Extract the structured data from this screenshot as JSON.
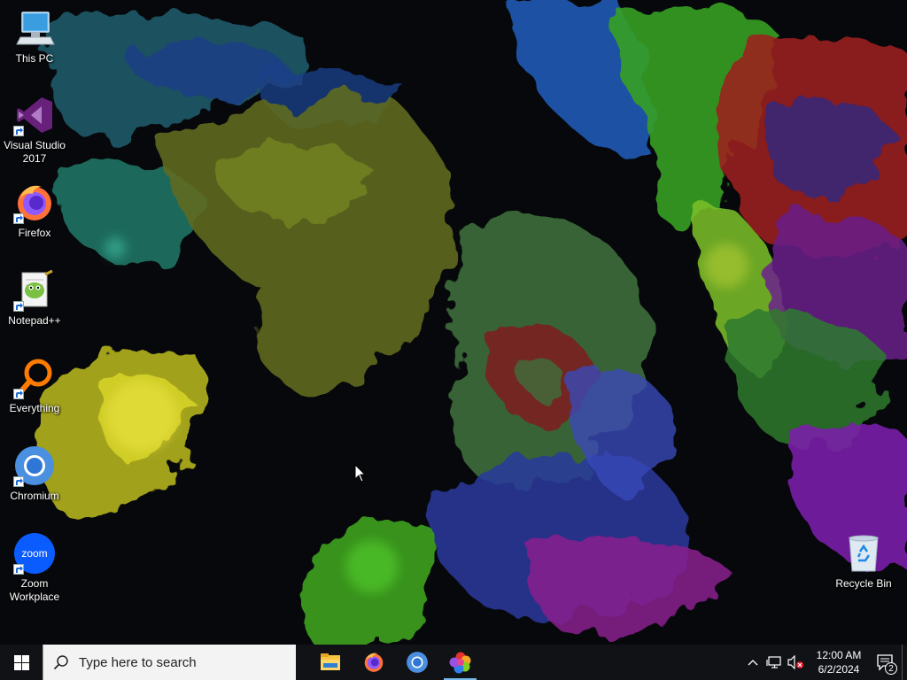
{
  "desktop": {
    "icons": [
      {
        "label": "This PC",
        "icon": "this-pc-icon"
      },
      {
        "label": "Visual Studio\n2017",
        "label_line1": "Visual Studio",
        "label_line2": "2017",
        "icon": "visual-studio-icon"
      },
      {
        "label": "Firefox",
        "icon": "firefox-icon"
      },
      {
        "label": "Notepad++",
        "icon": "notepad-plus-plus-icon"
      },
      {
        "label": "Everything",
        "icon": "everything-search-icon"
      },
      {
        "label": "Chromium",
        "icon": "chromium-icon"
      },
      {
        "label_line1": "Zoom",
        "label_line2": "Workplace",
        "icon": "zoom-icon",
        "badge": "zoom"
      }
    ],
    "recycle_bin": {
      "label": "Recycle Bin",
      "icon": "recycle-bin-icon"
    }
  },
  "taskbar": {
    "search_placeholder": "Type here to search",
    "apps": [
      {
        "name": "File Explorer",
        "icon": "file-explorer-icon"
      },
      {
        "name": "Firefox",
        "icon": "firefox-icon"
      },
      {
        "name": "Chromium",
        "icon": "chromium-icon"
      },
      {
        "name": "Color app",
        "icon": "color-wheel-icon",
        "active": true
      }
    ],
    "clock": {
      "time": "12:00 AM",
      "date": "6/2/2024"
    },
    "notification_count": "2"
  },
  "colors": {
    "taskbar_bg": "#101216",
    "accent": "#76b9ed",
    "search_bg": "#f3f3f3"
  }
}
